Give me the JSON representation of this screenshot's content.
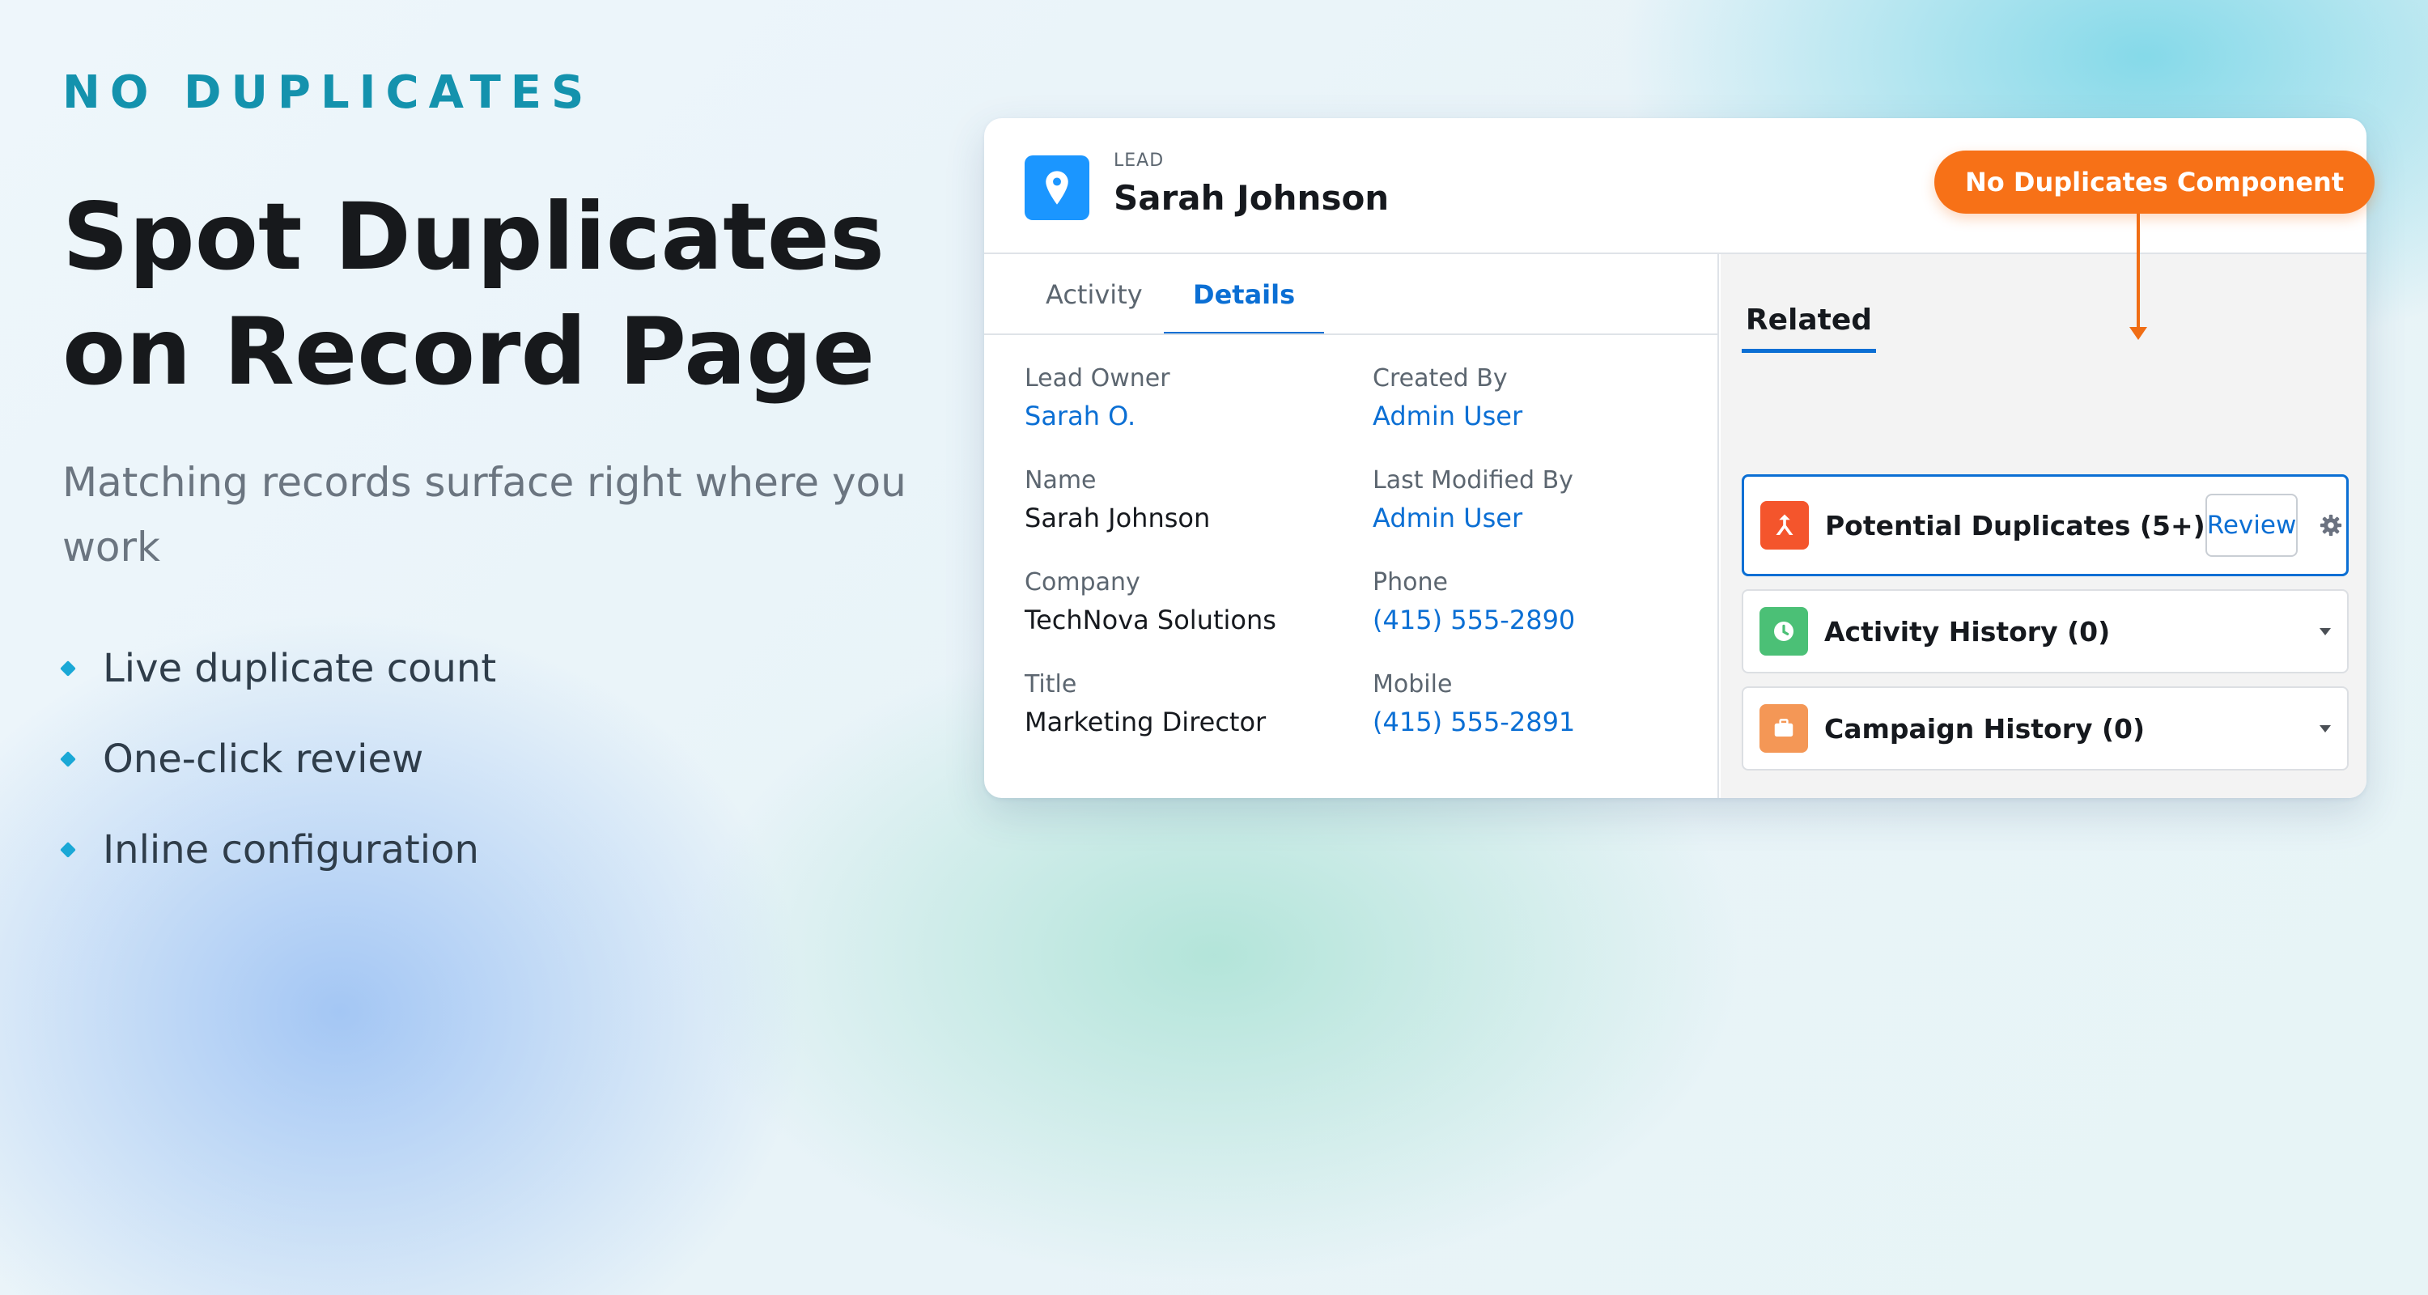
{
  "hero": {
    "eyebrow": "NO DUPLICATES",
    "headline": "Spot Duplicates on Record Page",
    "subhead": "Matching records surface right where you work",
    "bullets": [
      "Live duplicate count",
      "One-click review",
      "Inline configuration"
    ]
  },
  "record": {
    "type_label": "LEAD",
    "name": "Sarah Johnson",
    "icon": "map-pin-icon",
    "icon_color": "#1b96ff"
  },
  "badge": {
    "label": "No Duplicates Component",
    "color": "#f77117"
  },
  "tabs": [
    {
      "label": "Activity",
      "active": false
    },
    {
      "label": "Details",
      "active": true
    }
  ],
  "fields": {
    "lead_owner": {
      "label": "Lead Owner",
      "value": "Sarah O."
    },
    "created_by": {
      "label": "Created By",
      "value": "Admin User"
    },
    "name": {
      "label": "Name",
      "value": "Sarah Johnson"
    },
    "last_modified_by": {
      "label": "Last Modified By",
      "value": "Admin User"
    },
    "company": {
      "label": "Company",
      "value": "TechNova Solutions"
    },
    "phone": {
      "label": "Phone",
      "value": "(415) 555-2890"
    },
    "title": {
      "label": "Title",
      "value": "Marketing Director"
    },
    "mobile": {
      "label": "Mobile",
      "value": "(415) 555-2891"
    }
  },
  "related": {
    "tab_label": "Related",
    "cards": [
      {
        "title": "Potential Duplicates (5+)",
        "icon": "merge-icon",
        "icon_color": "#f4552c",
        "action": "Review"
      },
      {
        "title": "Activity History (0)",
        "icon": "clock-icon",
        "icon_color": "#4bc076"
      },
      {
        "title": "Campaign History (0)",
        "icon": "briefcase-icon",
        "icon_color": "#f49756"
      }
    ]
  },
  "colors": {
    "accent_blue": "#0b6fd4",
    "eyebrow_teal": "#1492ad"
  }
}
